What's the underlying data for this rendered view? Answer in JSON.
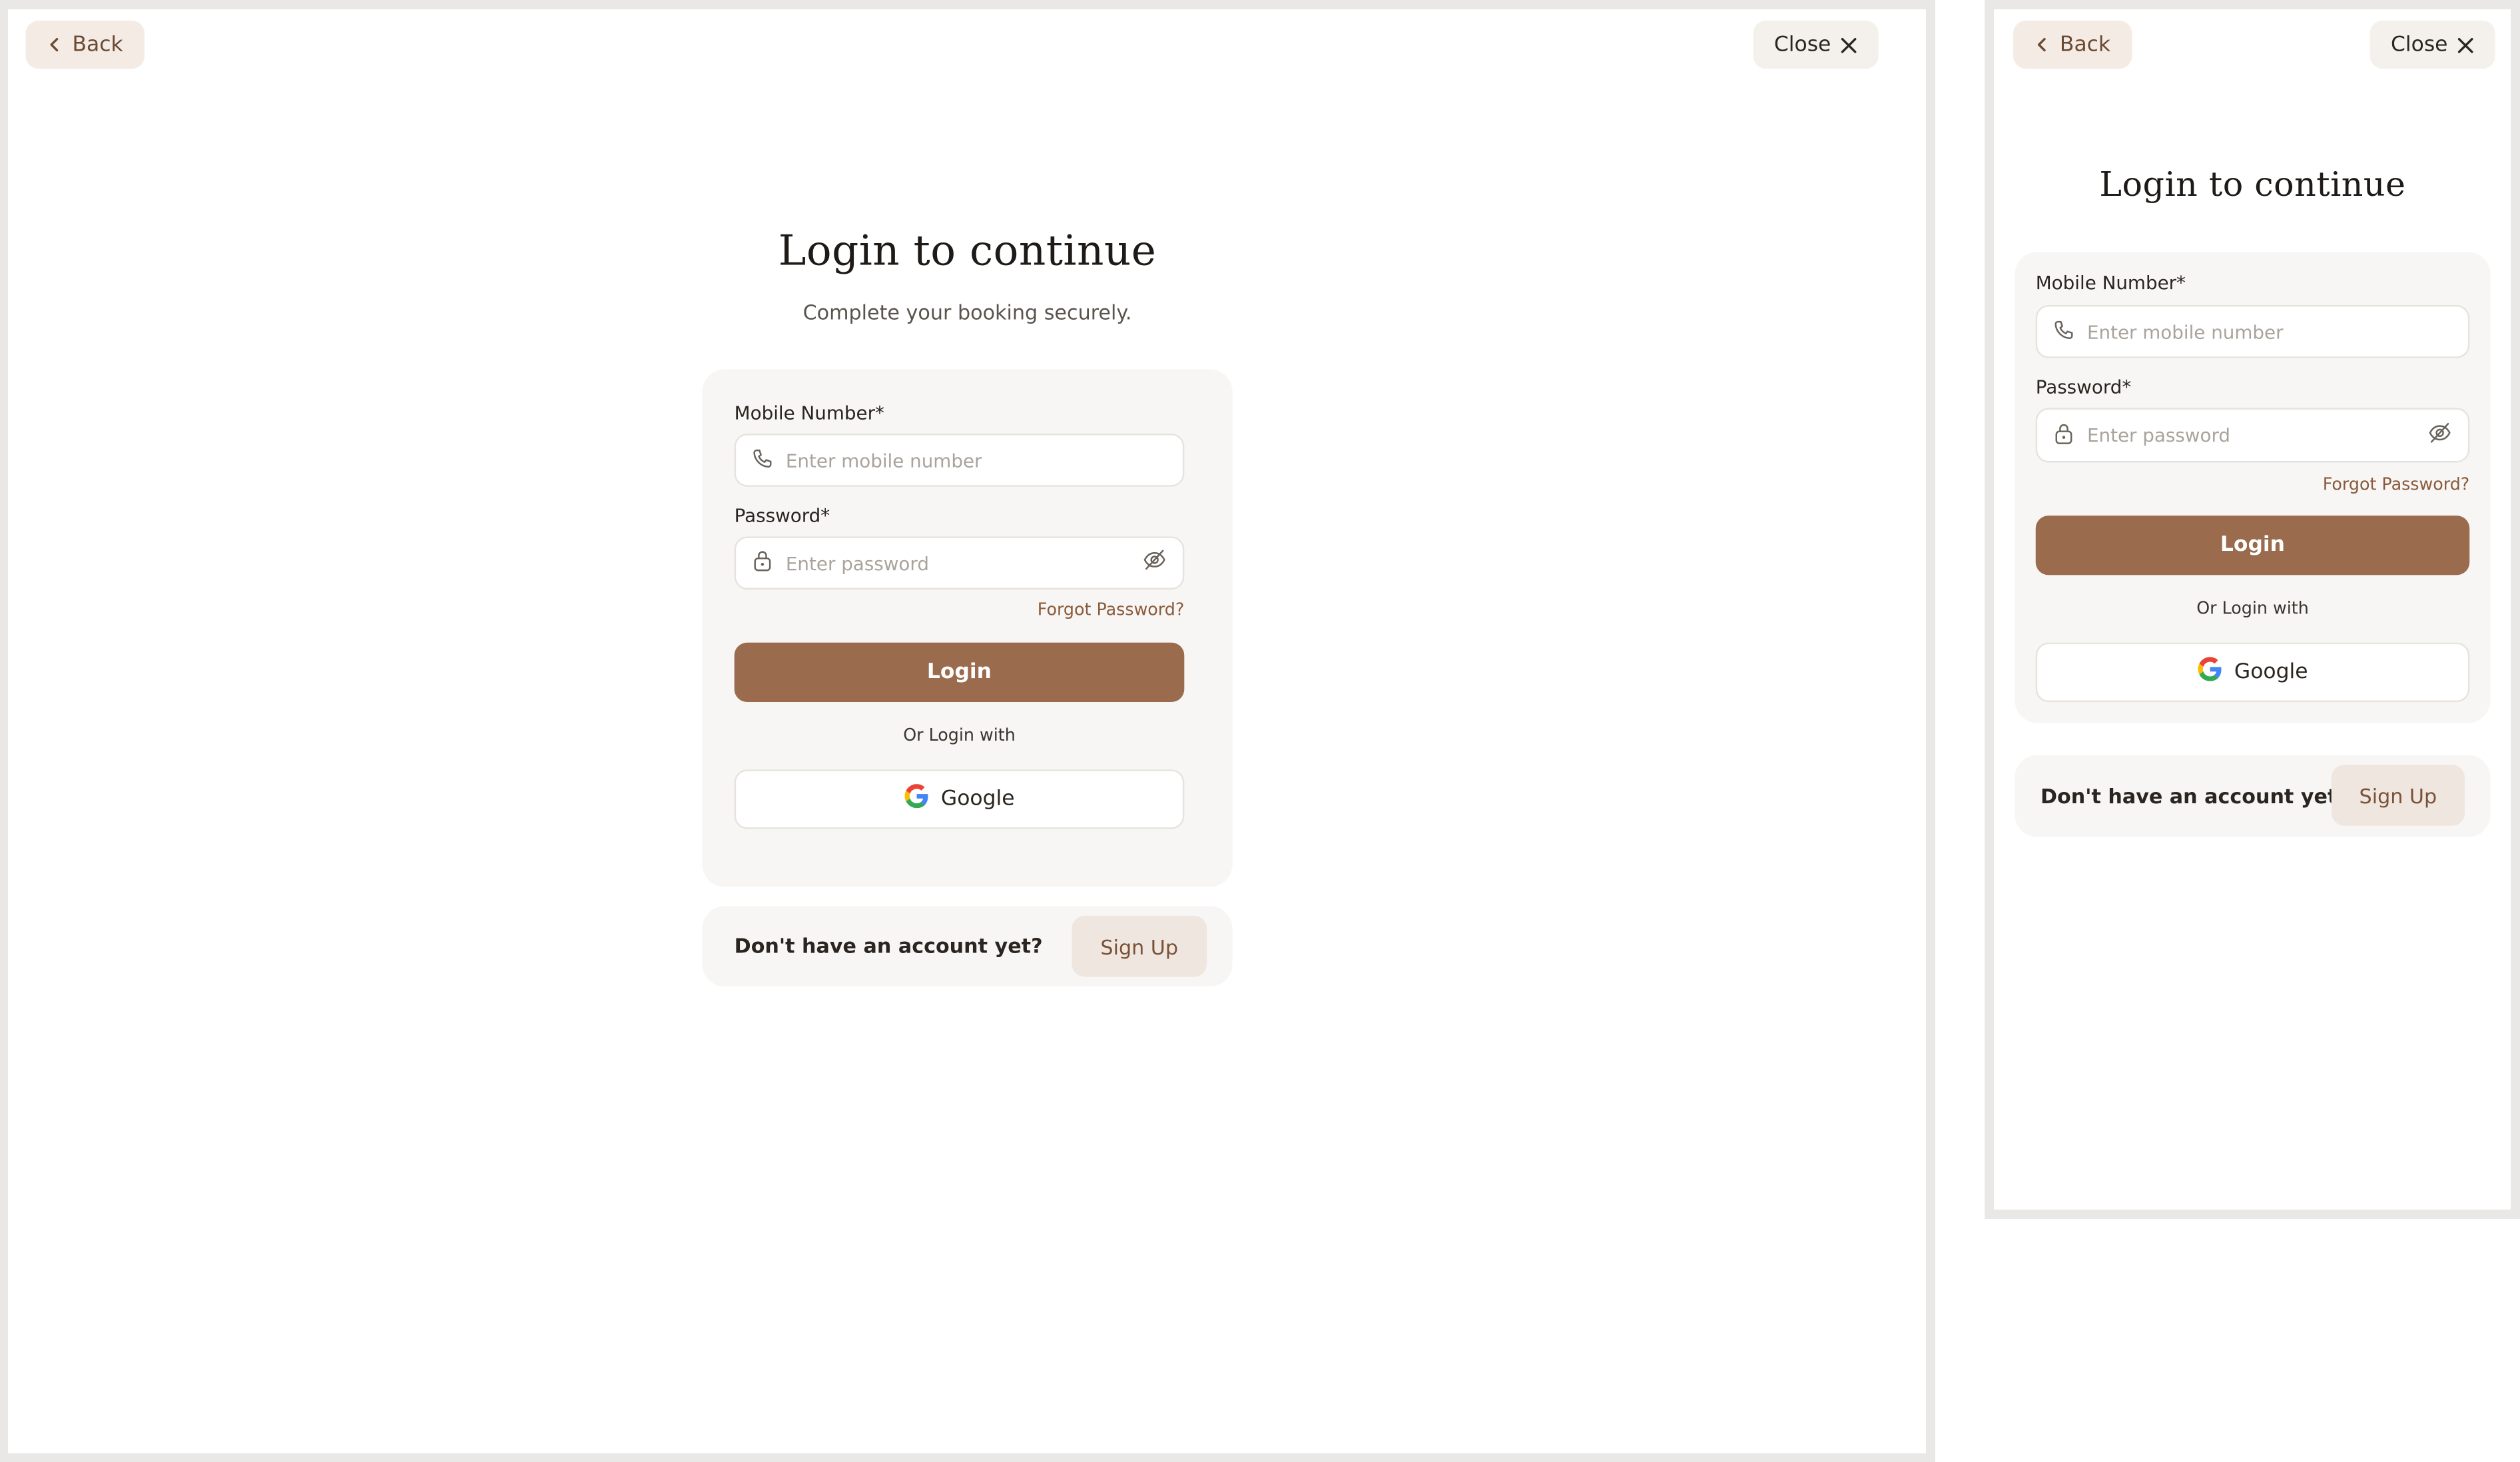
{
  "nav": {
    "back_label": "Back",
    "close_label": "Close"
  },
  "header": {
    "title": "Login to continue",
    "subtitle": "Complete your booking securely."
  },
  "form": {
    "mobile_label": "Mobile Number*",
    "mobile_placeholder": "Enter mobile number",
    "password_label": "Password*",
    "password_placeholder": "Enter password",
    "forgot_label": "Forgot Password?",
    "login_label": "Login",
    "or_label": "Or Login with",
    "google_label": "Google"
  },
  "footer": {
    "prompt": "Don't have an account yet?",
    "signup_label": "Sign Up"
  },
  "icons": {
    "back": "chevron-left-icon",
    "close": "close-icon",
    "phone": "phone-icon",
    "lock": "lock-icon",
    "visibility": "eye-off-icon",
    "google": "google-logo-icon"
  },
  "colors": {
    "accent": "#9a6b4c",
    "card_bg": "#f7f6f4",
    "back_bg": "#f4ebe4",
    "signup_bg": "#efe6df",
    "link": "#8a5a3b"
  }
}
